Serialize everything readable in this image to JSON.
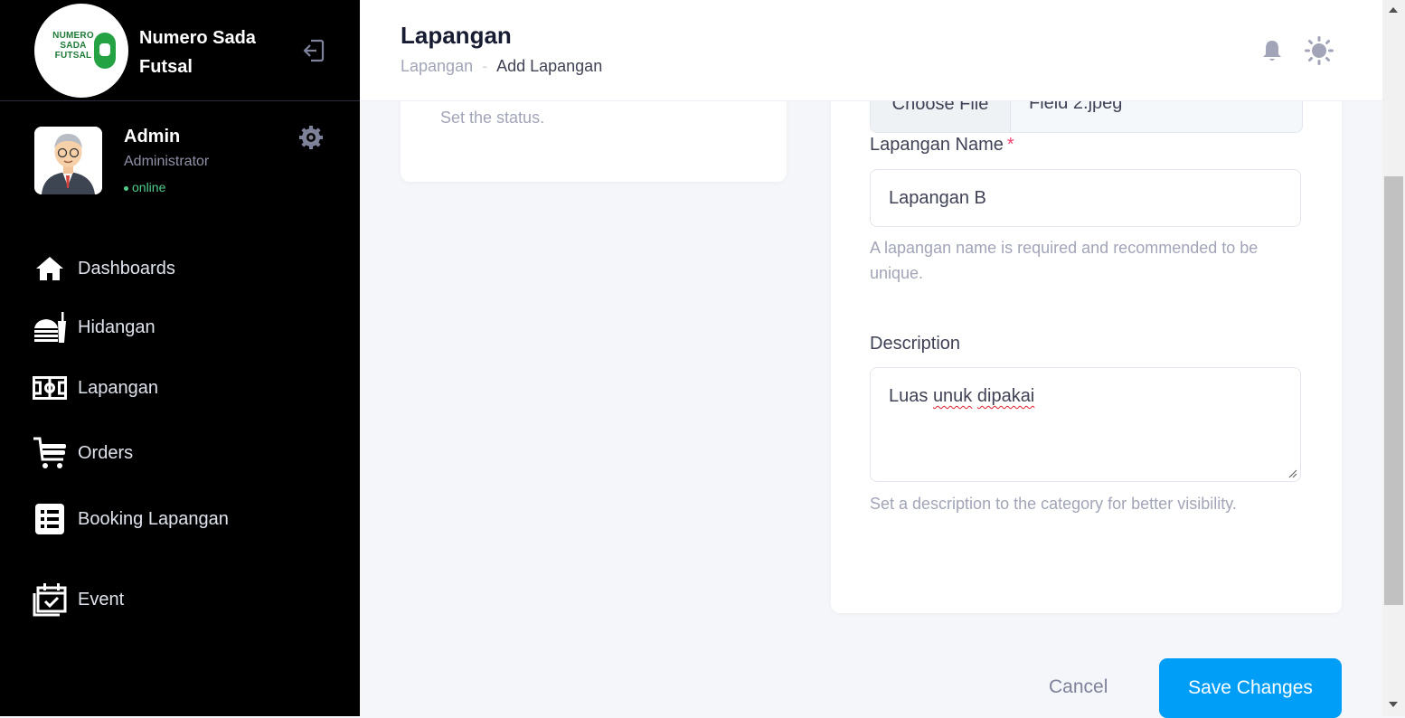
{
  "brand": {
    "logo_text": "NUMERO SADA FUTSAL",
    "name": "Numero Sada Futsal"
  },
  "user": {
    "name": "Admin",
    "role": "Administrator",
    "status": "online"
  },
  "nav": {
    "items": [
      {
        "label": "Dashboards",
        "icon": "home-icon"
      },
      {
        "label": "Hidangan",
        "icon": "food-icon"
      },
      {
        "label": "Lapangan",
        "icon": "field-icon"
      },
      {
        "label": "Orders",
        "icon": "cart-icon"
      },
      {
        "label": "Booking Lapangan",
        "icon": "list-icon"
      },
      {
        "label": "Event",
        "icon": "calendar-check-icon"
      }
    ]
  },
  "header": {
    "title": "Lapangan",
    "breadcrumb": {
      "parent": "Lapangan",
      "separator": "-",
      "current": "Add Lapangan"
    }
  },
  "status_card": {
    "help": "Set the status."
  },
  "form": {
    "file": {
      "button": "Choose File",
      "name": "Field 2.jpeg"
    },
    "name": {
      "label": "Lapangan Name",
      "required": "*",
      "value": "Lapangan B",
      "help": "A lapangan name is required and recommended to be unique."
    },
    "description": {
      "label": "Description",
      "value_plain": "Luas",
      "value_misspelled_1": "unuk",
      "value_misspelled_2": "dipakai",
      "help": "Set a description to the category for better visibility."
    }
  },
  "actions": {
    "cancel": "Cancel",
    "save": "Save Changes"
  },
  "colors": {
    "accent": "#009ef7",
    "sidebar": "#000000",
    "online": "#50cd89",
    "required": "#f1416c"
  }
}
